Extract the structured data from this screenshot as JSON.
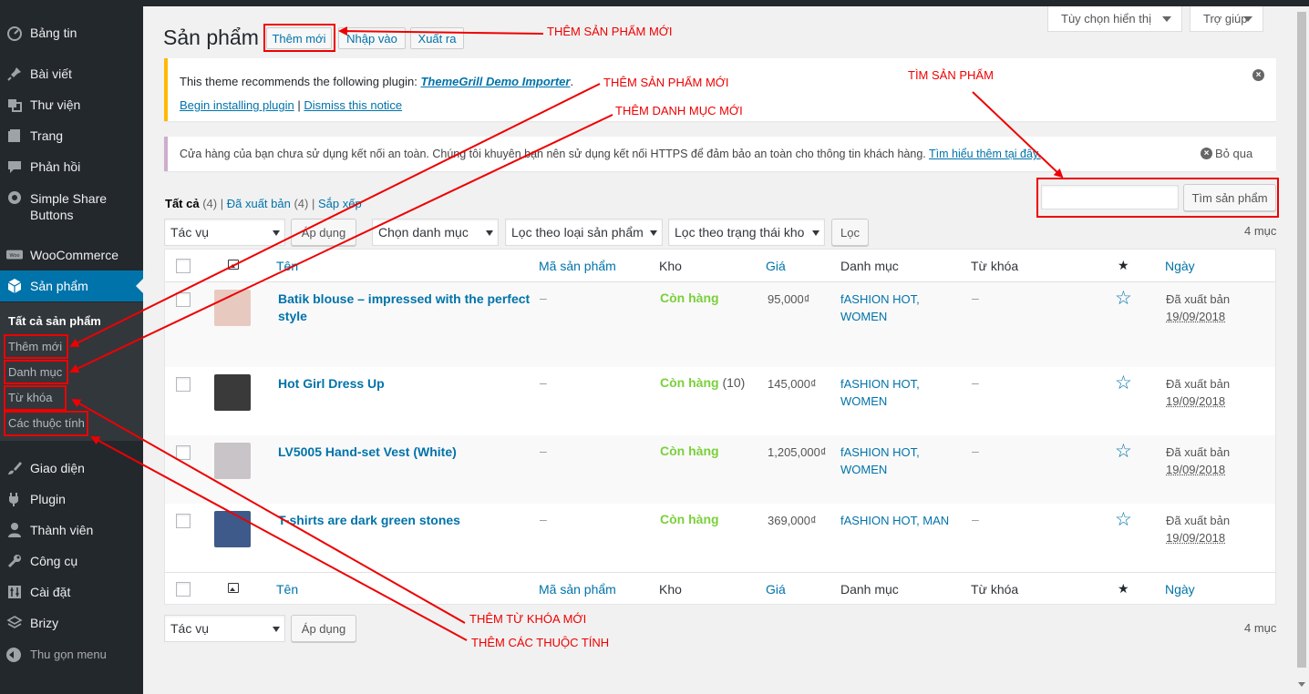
{
  "sidebar": {
    "items": [
      {
        "label": "Bảng tin",
        "icon": "dashboard-icon"
      },
      {
        "label": "Bài viết",
        "icon": "pin-icon"
      },
      {
        "label": "Thư viện",
        "icon": "media-icon"
      },
      {
        "label": "Trang",
        "icon": "page-icon"
      },
      {
        "label": "Phản hồi",
        "icon": "comment-icon"
      },
      {
        "label": "Simple Share Buttons",
        "icon": "share-icon"
      },
      {
        "label": "WooCommerce",
        "icon": "woo-icon"
      },
      {
        "label": "Sản phẩm",
        "icon": "box-icon"
      },
      {
        "label": "Giao diện",
        "icon": "brush-icon"
      },
      {
        "label": "Plugin",
        "icon": "plugin-icon"
      },
      {
        "label": "Thành viên",
        "icon": "user-icon"
      },
      {
        "label": "Công cụ",
        "icon": "wrench-icon"
      },
      {
        "label": "Cài đặt",
        "icon": "settings-icon"
      },
      {
        "label": "Brizy",
        "icon": "brizy-icon"
      }
    ],
    "submenu": [
      "Tất cả sản phẩm",
      "Thêm mới",
      "Danh mục",
      "Từ khóa",
      "Các thuộc tính"
    ],
    "collapse_label": "Thu gọn menu"
  },
  "screen_options": {
    "display": "Tùy chọn hiển thị",
    "help": "Trợ giúp"
  },
  "header": {
    "title": "Sản phẩm",
    "add_new": "Thêm mới",
    "import": "Nhập vào",
    "export": "Xuất ra"
  },
  "notice_plugin": {
    "text": "This theme recommends the following plugin:",
    "plugin_name": "ThemeGrill Demo Importer",
    "period": ".",
    "install": "Begin installing plugin",
    "separator": "|",
    "dismiss": "Dismiss this notice"
  },
  "notice_https": {
    "text": "Cửa hàng của bạn chưa sử dụng kết nối an toàn. Chúng tôi khuyên bạn nên sử dụng kết nối HTTPS để đảm bảo an toàn cho thông tin khách hàng.",
    "link": "Tìm hiểu thêm tại đây.",
    "dismiss": "Bỏ qua"
  },
  "views": {
    "all": "Tất cả",
    "all_count": "(4)",
    "sep": "|",
    "published": "Đã xuất bản",
    "published_count": "(4)",
    "sort": "Sắp xếp"
  },
  "filters": {
    "bulk_action": "Tác vụ",
    "apply": "Áp dụng",
    "category": "Chọn danh mục",
    "product_type": "Lọc theo loại sản phẩm",
    "stock_status": "Lọc theo trạng thái kho",
    "filter": "Lọc",
    "search_button": "Tìm sản phẩm",
    "search_value": "",
    "items_count": "4 mục"
  },
  "table": {
    "columns": {
      "name": "Tên",
      "sku": "Mã sản phẩm",
      "stock": "Kho",
      "price": "Giá",
      "categories": "Danh mục",
      "tags": "Từ khóa",
      "featured": "★",
      "date": "Ngày"
    },
    "rows": [
      {
        "name": "Batik blouse – impressed with the perfect style",
        "sku": "–",
        "stock": "Còn hàng",
        "stock_count": "",
        "price": "95,000₫",
        "categories": "fASHION HOT, WOMEN",
        "tags": "–",
        "status": "Đã xuất bản",
        "date": "19/09/2018",
        "thumb_color": "#e8c9c0"
      },
      {
        "name": "Hot Girl Dress Up",
        "sku": "–",
        "stock": "Còn hàng",
        "stock_count": "(10)",
        "price": "145,000₫",
        "categories": "fASHION HOT, WOMEN",
        "tags": "–",
        "status": "Đã xuất bản",
        "date": "19/09/2018",
        "thumb_color": "#3a3a3a"
      },
      {
        "name": "LV5005 Hand-set Vest (White)",
        "sku": "–",
        "stock": "Còn hàng",
        "stock_count": "",
        "price": "1,205,000₫",
        "categories": "fASHION HOT, WOMEN",
        "tags": "–",
        "status": "Đã xuất bản",
        "date": "19/09/2018",
        "thumb_color": "#c9c4c8"
      },
      {
        "name": "T-shirts are dark green stones",
        "sku": "–",
        "stock": "Còn hàng",
        "stock_count": "",
        "price": "369,000₫",
        "categories": "fASHION HOT, MAN",
        "tags": "–",
        "status": "Đã xuất bản",
        "date": "19/09/2018",
        "thumb_color": "#3d5a8a"
      }
    ]
  },
  "annotations": {
    "add_product_top": "THÊM SẢN PHẨM MỚI",
    "add_product_side": "THÊM SẢN PHẨM MỚI",
    "add_category": "THÊM DANH MỤC MỚI",
    "search_product": "TÌM SẢN PHẨM",
    "add_tag": "THÊM TỪ KHÓA MỚI",
    "add_attribute": "THÊM CÁC THUỘC TÍNH"
  },
  "colors": {
    "accent": "#0073aa",
    "sidebar": "#23282d",
    "in_stock": "#7ad03a",
    "annotation": "#e00000"
  }
}
